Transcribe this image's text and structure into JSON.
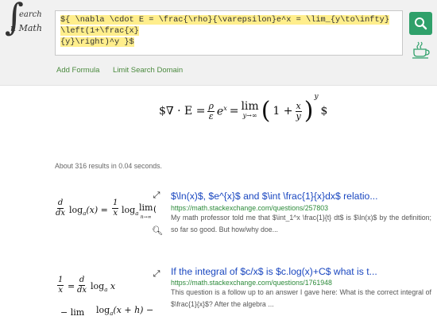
{
  "logo": {
    "integral": "∫",
    "line1": "earch",
    "line2": "n Math",
    "circle": "∮"
  },
  "query": {
    "line1": "${ \\nabla \\cdot E = \\frac{\\rho}{\\varepsilon}e^x = \\lim_{y\\to\\infty} \\left(1+\\frac{x}",
    "line2": "{y}\\right)^y }$"
  },
  "icons": {
    "search": "search-icon",
    "teacup": "teacup-icon",
    "expand": "expand-icon",
    "zoom": "magnifier-icon"
  },
  "colors": {
    "accent": "#2fa06a",
    "link": "#1a47c0",
    "url": "#2c8a3a",
    "highlight": "#ffee8c"
  },
  "nav": {
    "add_formula": "Add Formula",
    "limit_search": "Limit Search Domain"
  },
  "rendered_formula": {
    "lhs": "$∇ · E =",
    "rho": "ρ",
    "eps": "ε",
    "exp": "e",
    "exp_sup": "x",
    "eq": "=",
    "lim": "lim",
    "lim_sub": "y→∞",
    "one_plus": "1 +",
    "x": "x",
    "y": "y",
    "pow": "y",
    "end": "$"
  },
  "results_summary": "About 316 results in 0.04 seconds.",
  "results": [
    {
      "title": "$\\ln(x)$, $e^{x}$ and $\\int \\frac{1}{x}dx$ relatio...",
      "url": "https://math.stackexchange.com/questions/257803",
      "snippet": "My math professor told me that $\\int_1^x \\frac{1}{t} dt$ is $\\ln(x)$ by the definition; so far so good. But how/why doe...",
      "thumb": {
        "d": "d",
        "dx": "dx",
        "log": "log",
        "a": "a",
        "x": "(x) =",
        "one": "1",
        "x2": "x",
        "lim": "lim",
        "sub": "n→∞",
        "tail": "(:"
      }
    },
    {
      "title": "If the integral of $c/x$ is $c.log(x)+C$ what is t...",
      "url": "https://math.stackexchange.com/questions/1761948",
      "snippet": "This question is a follow up to an answer I gave here: What is the correct integral of $\\frac{1}{x}$? After the algebra ...",
      "thumb": {
        "one": "1",
        "x": "x",
        "eq": "=",
        "d": "d",
        "dx": "dx",
        "log": "log",
        "a": "a",
        "x2": "x",
        "line2": "log",
        "tail": "(x + h) −",
        "lim": "− lim"
      }
    }
  ]
}
